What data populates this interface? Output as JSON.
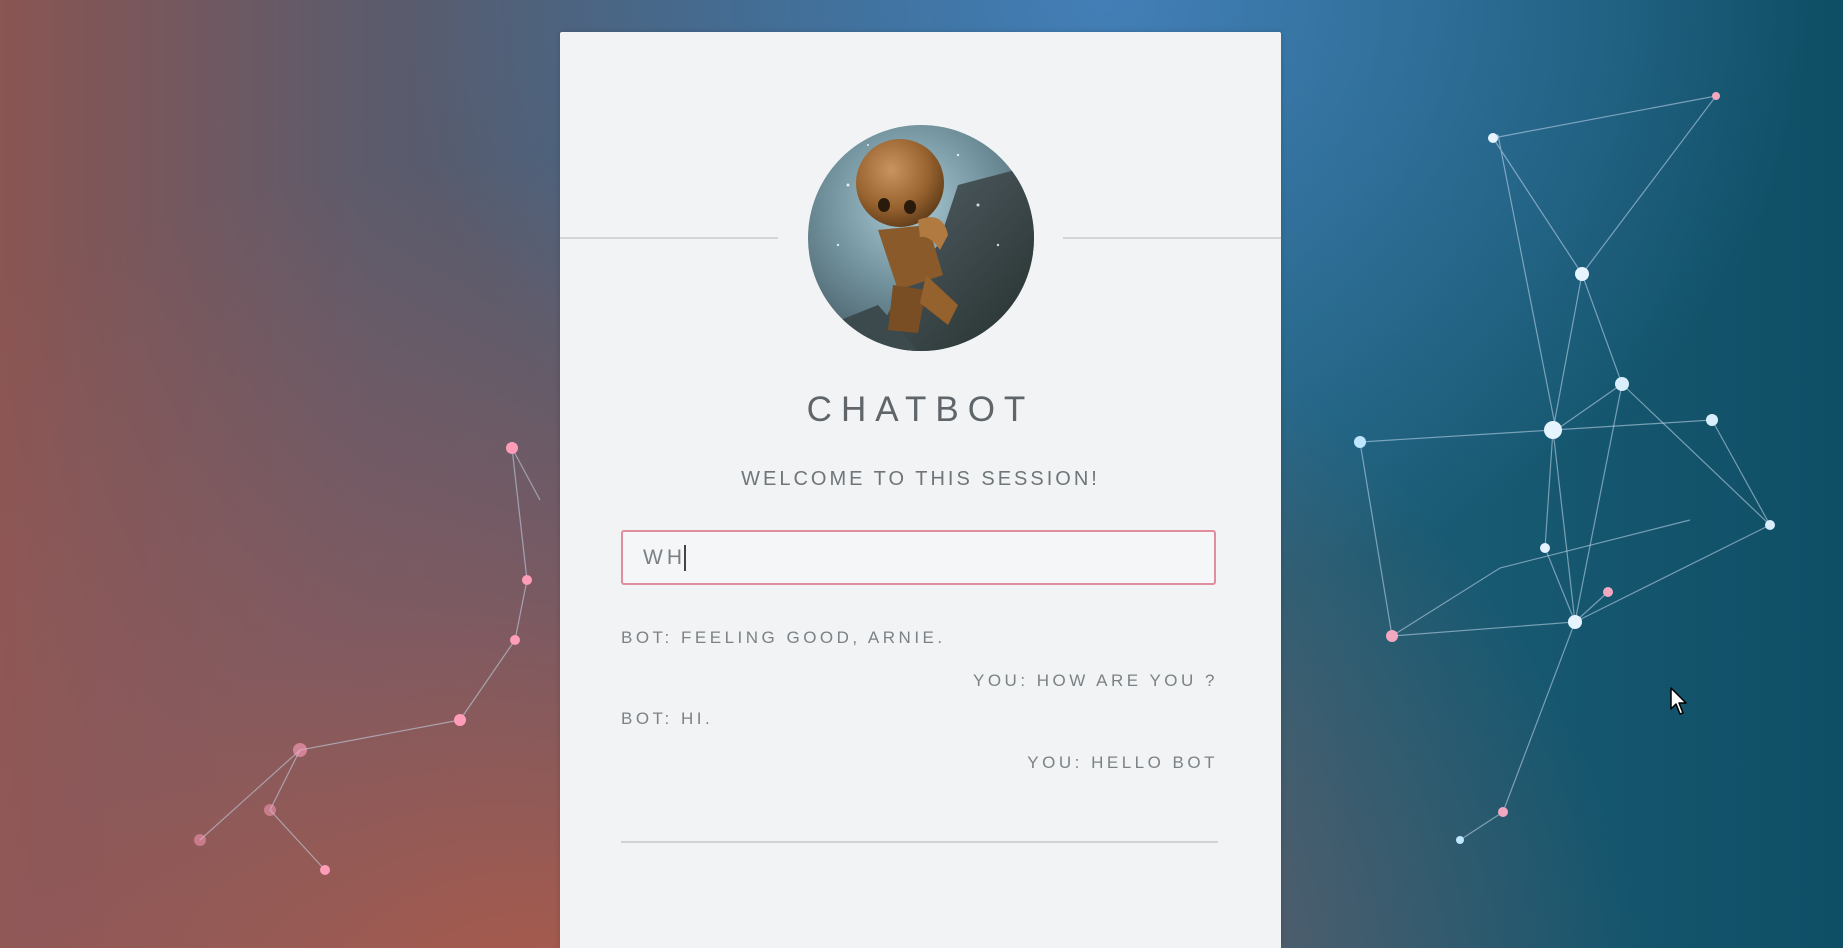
{
  "app": {
    "title": "CHATBOT",
    "welcome": "WELCOME TO THIS SESSION!"
  },
  "input": {
    "value": "WH",
    "placeholder": ""
  },
  "messages": [
    {
      "sender": "bot",
      "text": "BOT: FEELING GOOD, ARNIE."
    },
    {
      "sender": "you",
      "text": "YOU: HOW ARE YOU ?"
    },
    {
      "sender": "bot",
      "text": "BOT: HI."
    },
    {
      "sender": "you",
      "text": "YOU: HELLO BOT"
    }
  ],
  "colors": {
    "card_bg": "#f1f3f4",
    "input_border": "#e08d9f",
    "text": "#7b8286"
  },
  "icons": {
    "avatar": "robot-avatar",
    "pointer": "mouse-cursor-icon"
  }
}
